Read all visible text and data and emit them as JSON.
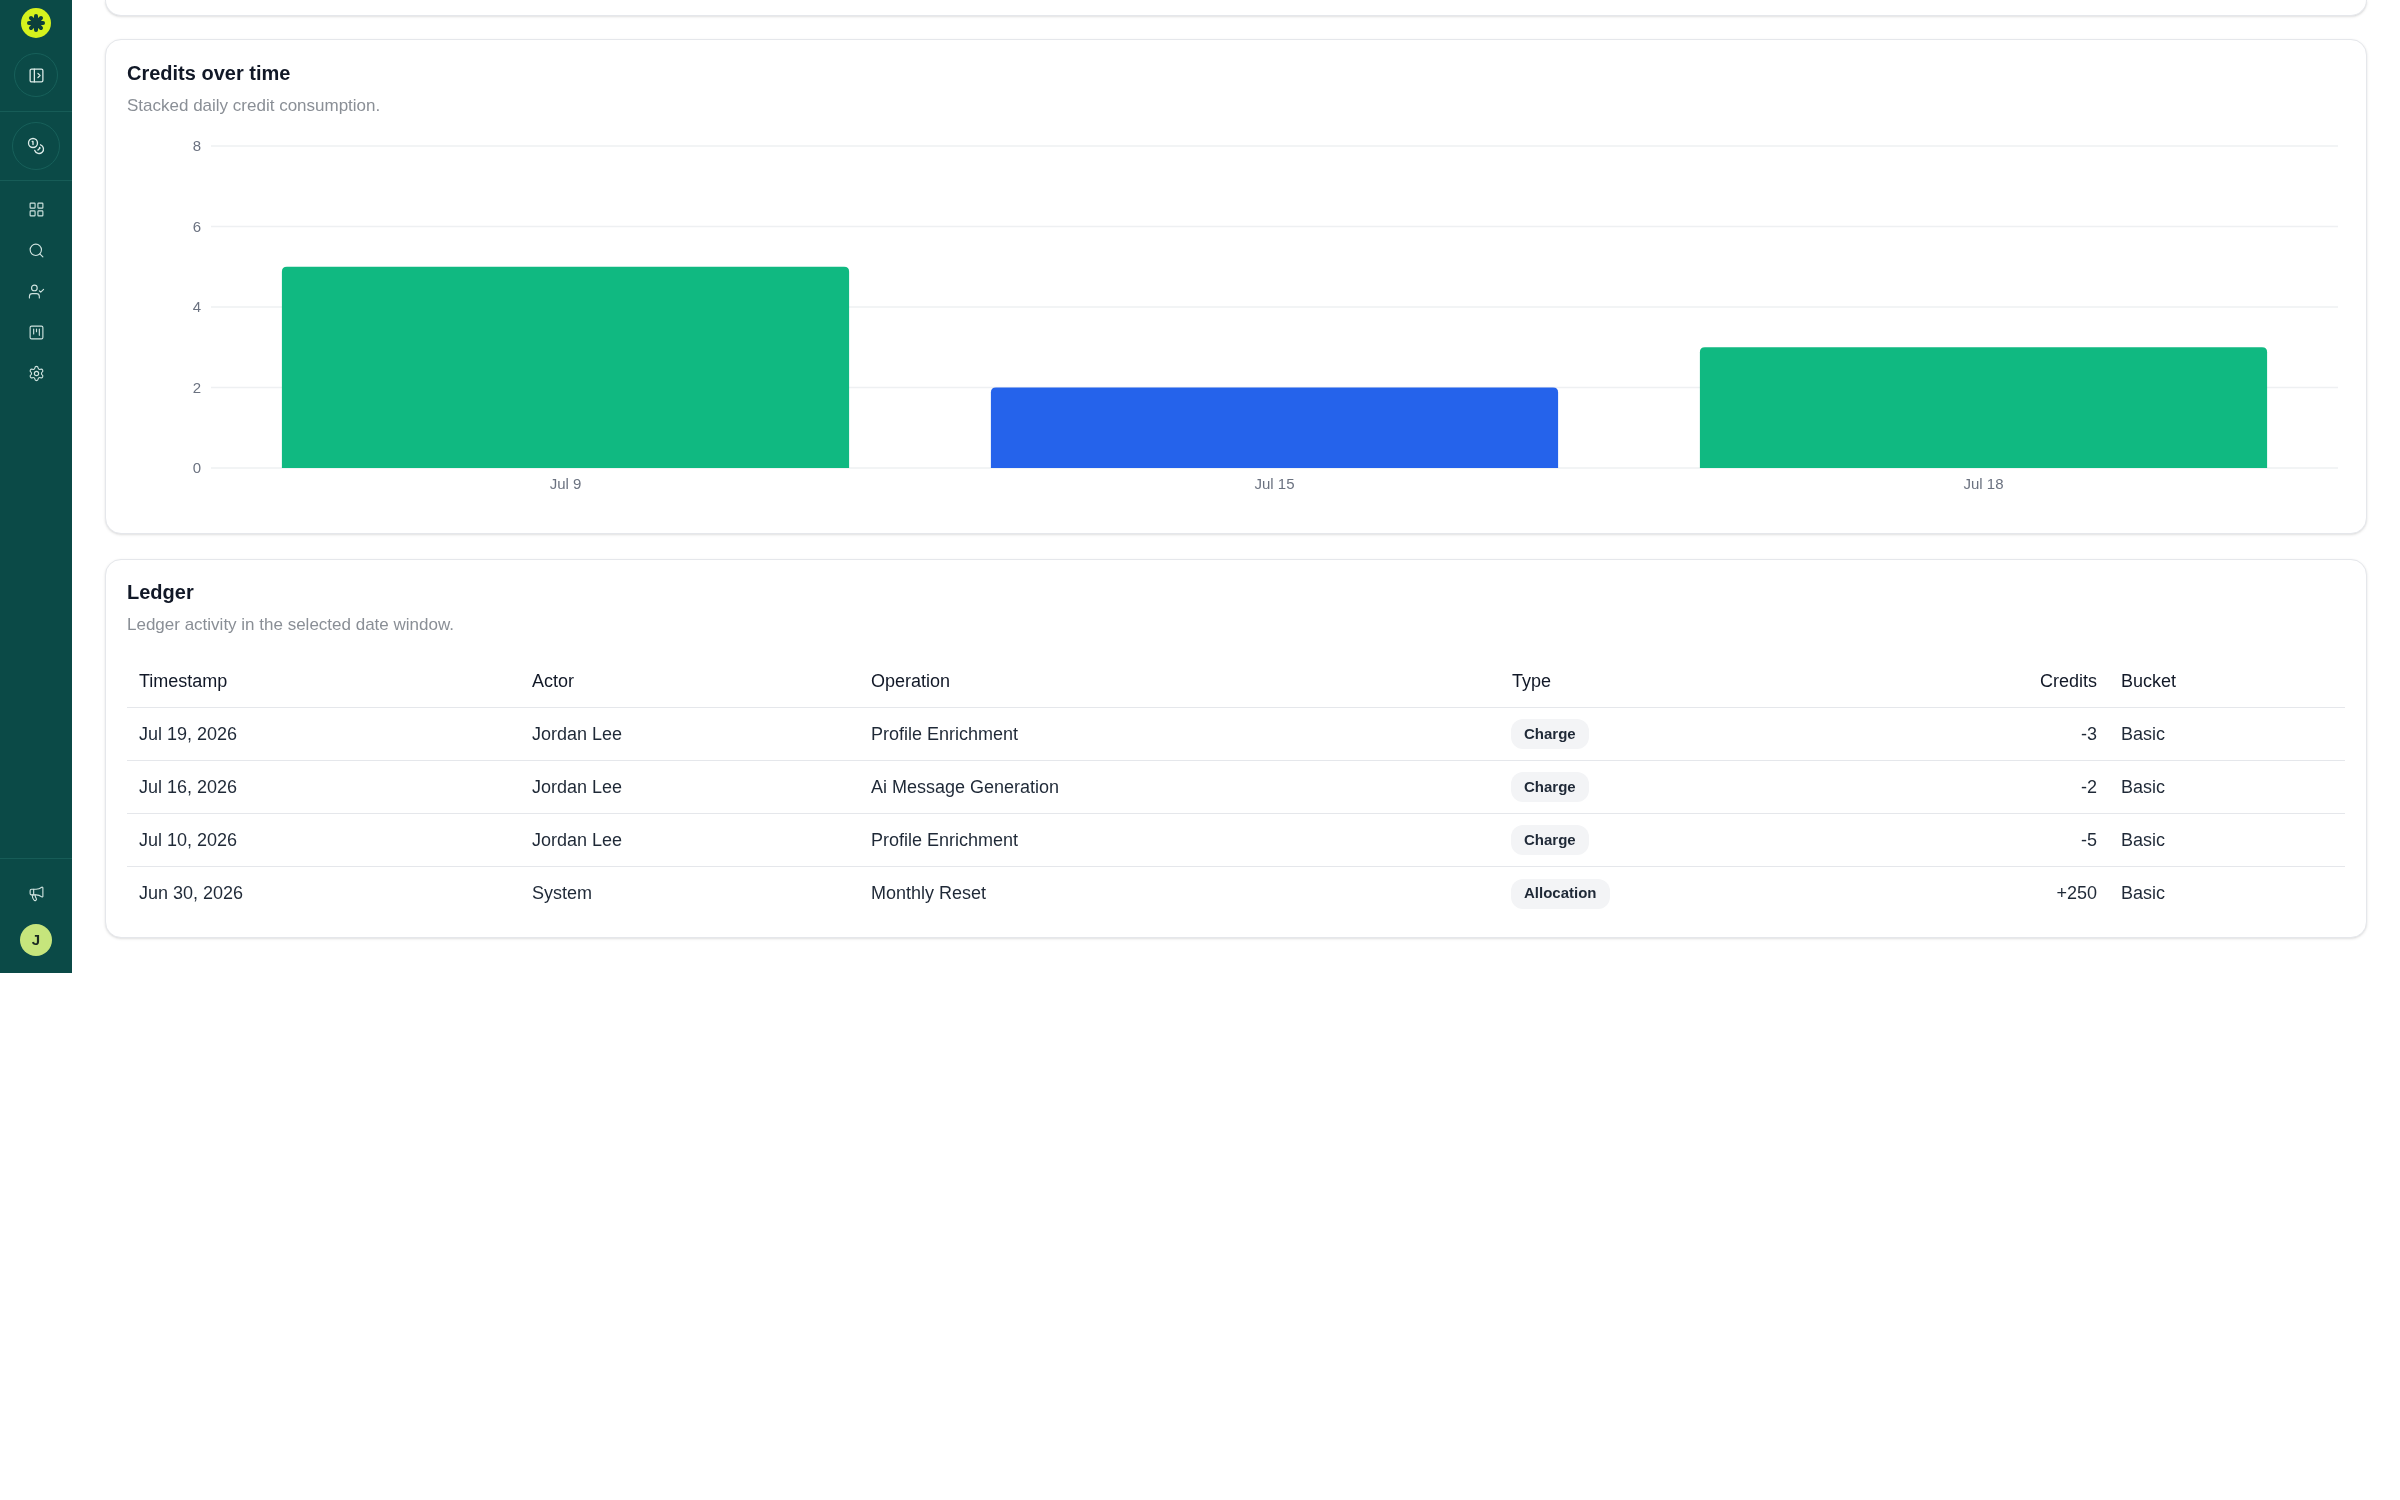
{
  "sidebar": {
    "avatar": {
      "initial": "J"
    }
  },
  "credits_over_time": {
    "title": "Credits over time",
    "subtitle": "Stacked daily credit consumption.",
    "chart_data": {
      "type": "bar",
      "categories": [
        "Jul 9",
        "Jul 15",
        "Jul 18"
      ],
      "series": [
        {
          "color": "#10b981",
          "values": [
            5,
            0,
            3
          ]
        },
        {
          "color": "#2563eb",
          "values": [
            0,
            2,
            0
          ]
        }
      ],
      "stacked": true,
      "grid": true,
      "ylim": [
        0,
        8
      ],
      "yticks": [
        0,
        2,
        4,
        6,
        8
      ]
    }
  },
  "ledger": {
    "title": "Ledger",
    "subtitle": "Ledger activity in the selected date window.",
    "table": {
      "columns": [
        "Timestamp",
        "Actor",
        "Operation",
        "Type",
        "Credits",
        "Bucket"
      ],
      "rows": [
        {
          "timestamp": "Jul 19, 2026",
          "actor": "Jordan Lee",
          "operation": "Profile Enrichment",
          "type": "Charge",
          "credits": "-3",
          "bucket": "Basic"
        },
        {
          "timestamp": "Jul 16, 2026",
          "actor": "Jordan Lee",
          "operation": "Ai Message Generation",
          "type": "Charge",
          "credits": "-2",
          "bucket": "Basic"
        },
        {
          "timestamp": "Jul 10, 2026",
          "actor": "Jordan Lee",
          "operation": "Profile Enrichment",
          "type": "Charge",
          "credits": "-5",
          "bucket": "Basic"
        },
        {
          "timestamp": "Jun 30, 2026",
          "actor": "System",
          "operation": "Monthly Reset",
          "type": "Allocation",
          "credits": "+250",
          "bucket": "Basic"
        }
      ]
    }
  }
}
